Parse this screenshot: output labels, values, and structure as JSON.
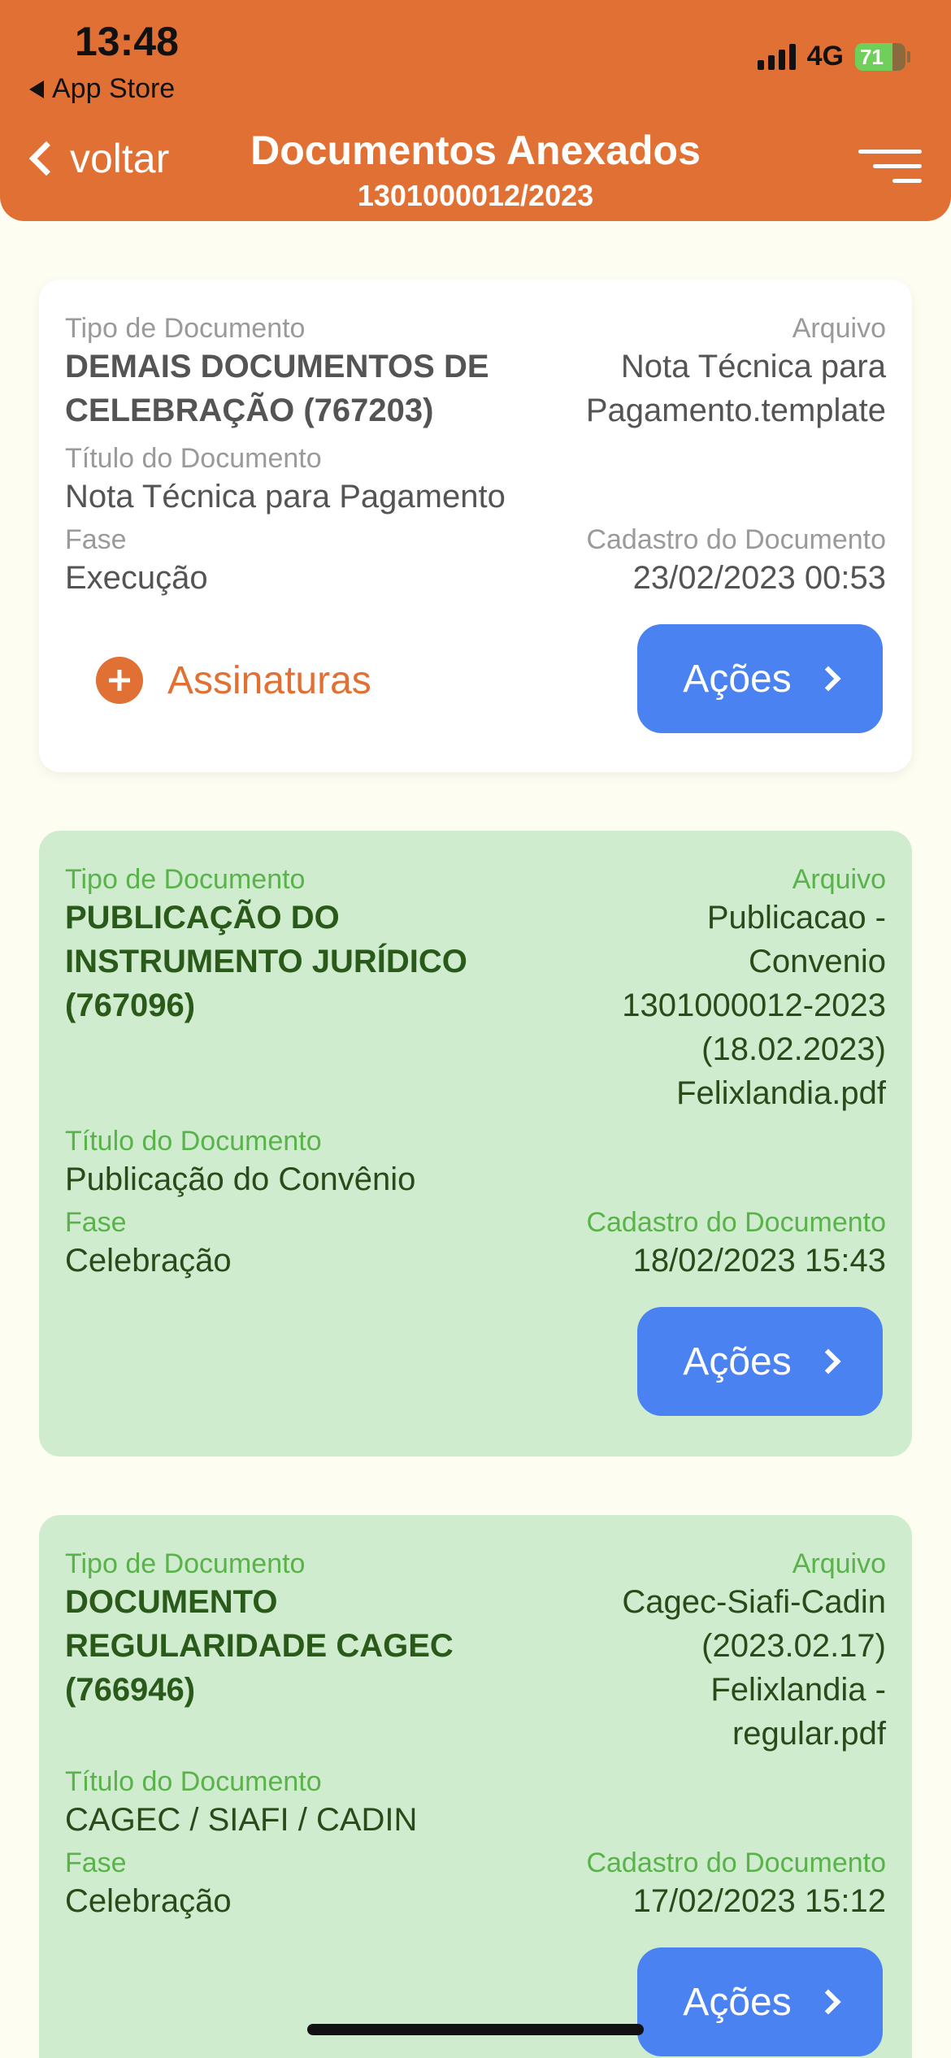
{
  "status_bar": {
    "time": "13:48",
    "back_app": "App Store",
    "network": "4G",
    "battery": "71"
  },
  "header": {
    "back_label": "voltar",
    "title": "Documentos Anexados",
    "subtitle": "1301000012/2023",
    "accent_color": "#e07033"
  },
  "labels": {
    "tipo": "Tipo de Documento",
    "arquivo": "Arquivo",
    "titulo": "Título do Documento",
    "fase": "Fase",
    "cadastro": "Cadastro do Documento",
    "acoes": "Ações",
    "assinaturas": "Assinaturas"
  },
  "documents": [
    {
      "tipo": [
        "DEMAIS DOCUMENTOS DE",
        "CELEBRAÇÃO (767203)"
      ],
      "arquivo": [
        "Nota Técnica para",
        "Pagamento.template"
      ],
      "titulo": "Nota Técnica para Pagamento",
      "fase": "Execução",
      "cadastro": "23/02/2023 00:53",
      "style": "white"
    },
    {
      "tipo": [
        "PUBLICAÇÃO DO",
        "INSTRUMENTO JURÍDICO",
        "(767096)"
      ],
      "arquivo": [
        "Publicacao -",
        "Convenio",
        "1301000012-2023",
        "(18.02.2023)",
        "Felixlandia.pdf"
      ],
      "titulo": "Publicação do Convênio",
      "fase": "Celebração",
      "cadastro": "18/02/2023 15:43",
      "style": "green"
    },
    {
      "tipo": [
        "DOCUMENTO",
        "REGULARIDADE CAGEC",
        "(766946)"
      ],
      "arquivo": [
        "Cagec-Siafi-Cadin",
        "(2023.02.17)",
        "Felixlandia -",
        "regular.pdf"
      ],
      "titulo": "CAGEC / SIAFI / CADIN",
      "fase": "Celebração",
      "cadastro": "17/02/2023 15:12",
      "style": "green"
    }
  ]
}
